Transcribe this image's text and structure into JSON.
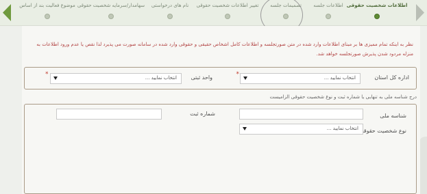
{
  "wizard": {
    "steps": [
      {
        "label": "اطلاعات شخصیت حقوقی",
        "active": true
      },
      {
        "label": "اطلاعات جلسه",
        "active": false
      },
      {
        "label": "تصمیمات جلسه",
        "active": false
      },
      {
        "label": "تغییر اطلاعات شخصیت حقوقی",
        "active": false
      },
      {
        "label": "نام های درخواستی",
        "active": false
      },
      {
        "label": "سهامدار/سرمایه شخصیت حقوقی",
        "active": false
      },
      {
        "label": "موضوع فعالیت بند از اساس",
        "active": false
      }
    ]
  },
  "notice": "نظر به اینکه تمام ممیزی ها بر مبنای اطلاعات وارد شده در متن صورتجلسه و اطلاعات کامل اشخاص حقیقی و حقوقی وارد شده در سامانه صورت می پذیرد لذا نقص یا عدم ورود اطلاعات به منزله مردود شدن پذیرش صورتجلسه خواهد شد.",
  "form1": {
    "province_office_label": "اداره کل استان",
    "province_office_value": "انتخاب نمایید ...",
    "unit_label": "واحد ثبتی",
    "unit_value": "انتخاب نمایید ...",
    "required_mark": "*"
  },
  "hint": "درج شناسه ملی به تنهایی یا شماره ثبت و نوع شخصیت حقوقی الزامیست",
  "form2": {
    "national_id_label": "شناسه ملی",
    "registration_no_label": "شماره ثبت",
    "entity_type_label": "نوع شخصیت حقوقی",
    "entity_type_value": "انتخاب نمایید ..."
  },
  "colors": {
    "accent_green": "#5e8a34",
    "warning_red": "#b24343",
    "wizard_bg": "#e9eee4"
  }
}
